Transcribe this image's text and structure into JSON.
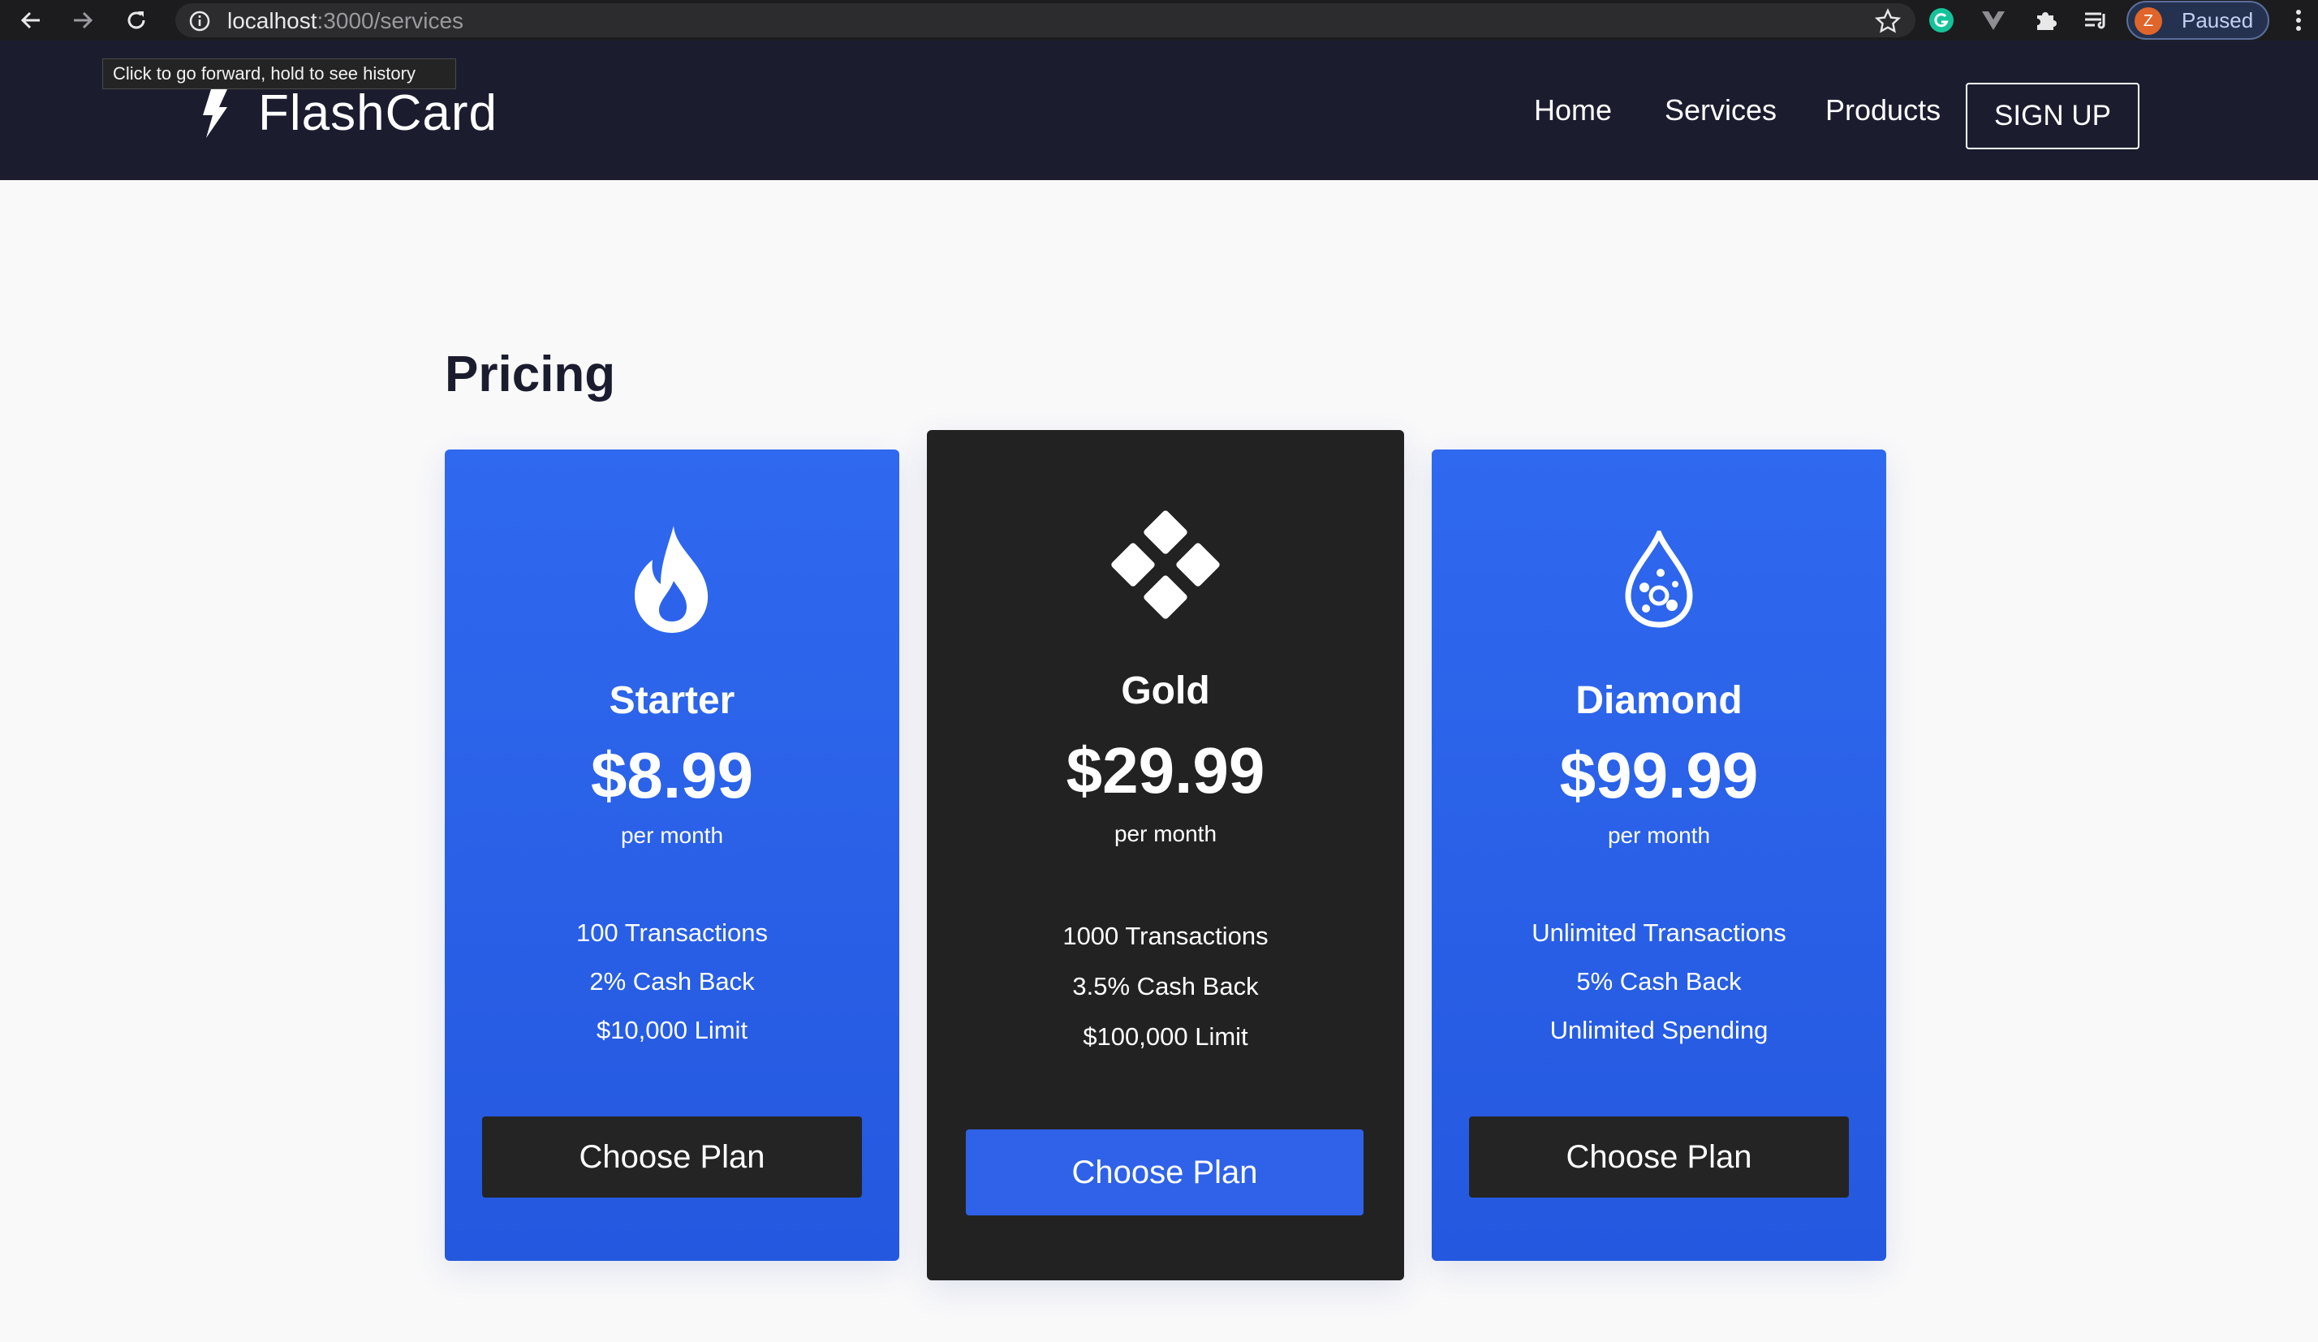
{
  "browser": {
    "url_host": "localhost",
    "url_path": ":3000/services",
    "profile_initial": "Z",
    "profile_status": "Paused",
    "tooltip": "Click to go forward, hold to see history",
    "colors": {
      "bar": "#1c1c1e",
      "profile_avatar": "#e0652a"
    }
  },
  "navbar": {
    "brand": "FlashCard",
    "links": [
      "Home",
      "Services",
      "Products"
    ],
    "signup_label": "SIGN UP",
    "colors": {
      "background": "#1b1d2f"
    }
  },
  "pricing": {
    "title": "Pricing",
    "plans": [
      {
        "name": "Starter",
        "icon": "fire-icon",
        "price": "$8.99",
        "period": "per month",
        "features": [
          "100 Transactions",
          "2% Cash Back",
          "$10,000 Limit"
        ],
        "button": "Choose Plan",
        "theme": "#2d63eb"
      },
      {
        "name": "Gold",
        "icon": "diamond-grid-icon",
        "price": "$29.99",
        "period": "per month",
        "features": [
          "1000 Transactions",
          "3.5% Cash Back",
          "$100,000 Limit"
        ],
        "button": "Choose Plan",
        "theme": "#222222"
      },
      {
        "name": "Diamond",
        "icon": "water-drop-icon",
        "price": "$99.99",
        "period": "per month",
        "features": [
          "Unlimited Transactions",
          "5% Cash Back",
          "Unlimited Spending"
        ],
        "button": "Choose Plan",
        "theme": "#2d63eb"
      }
    ]
  }
}
